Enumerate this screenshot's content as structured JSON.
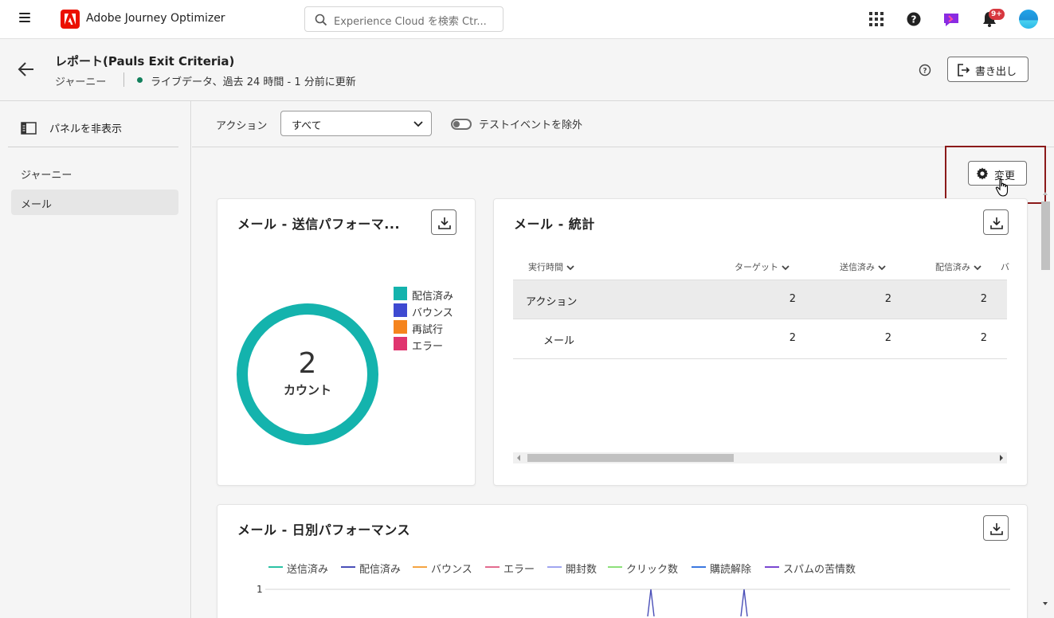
{
  "topbar": {
    "app_title": "Adobe Journey Optimizer",
    "search_placeholder": "Experience Cloud を検索 Ctr...",
    "notification_badge": "9+",
    "colors": {
      "adobe_red": "#eb1000",
      "badge": "#d7373f"
    }
  },
  "header": {
    "title": "レポート(Pauls Exit Criteria)",
    "type": "ジャーニー",
    "live_status": "ライブデータ、過去 24 時間 - 1 分前に更新",
    "export_label": "書き出し",
    "colors": {
      "live_dot": "#12805c"
    }
  },
  "sidebar": {
    "hide_panel_label": "パネルを非表示",
    "items": [
      {
        "label": "ジャーニー",
        "active": false
      },
      {
        "label": "メール",
        "active": true
      }
    ]
  },
  "filters": {
    "action_label": "アクション",
    "action_value": "すべて",
    "test_event_label": "テストイベントを除外",
    "test_event_on": false,
    "change_label": "変更"
  },
  "send_performance": {
    "title": "メール - 送信パフォーマ...",
    "center_value": "2",
    "center_label": "カウント",
    "legend": [
      {
        "label": "配信済み",
        "color": "#14b3ad"
      },
      {
        "label": "バウンス",
        "color": "#3e4ad1"
      },
      {
        "label": "再試行",
        "color": "#f5841e"
      },
      {
        "label": "エラー",
        "color": "#e0356f"
      }
    ],
    "chart_data": {
      "type": "pie",
      "categories": [
        "配信済み",
        "バウンス",
        "再試行",
        "エラー"
      ],
      "values": [
        2,
        0,
        0,
        0
      ],
      "total": 2
    }
  },
  "stats": {
    "title": "メール - 統計",
    "columns": [
      "実行時間",
      "ターゲット",
      "送信済み",
      "配信済み",
      "バ"
    ],
    "rows": [
      {
        "name": "アクション",
        "target": "2",
        "sent": "2",
        "delivered": "2"
      },
      {
        "name": "メール",
        "target": "2",
        "sent": "2",
        "delivered": "2"
      }
    ]
  },
  "daily": {
    "title": "メール - 日別パフォーマンス",
    "y_tick": "1",
    "legend": [
      {
        "label": "送信済み",
        "color": "#2cc2a4"
      },
      {
        "label": "配信済み",
        "color": "#4a4fb8"
      },
      {
        "label": "バウンス",
        "color": "#f5a442"
      },
      {
        "label": "エラー",
        "color": "#e36b8f"
      },
      {
        "label": "開封数",
        "color": "#a0a6f0"
      },
      {
        "label": "クリック数",
        "color": "#8de07a"
      },
      {
        "label": "購読解除",
        "color": "#3b78e0"
      },
      {
        "label": "スパムの苦情数",
        "color": "#7a47d1"
      }
    ],
    "chart_data": {
      "type": "line",
      "ylim": [
        0,
        1
      ],
      "yticks": [
        1
      ]
    }
  }
}
